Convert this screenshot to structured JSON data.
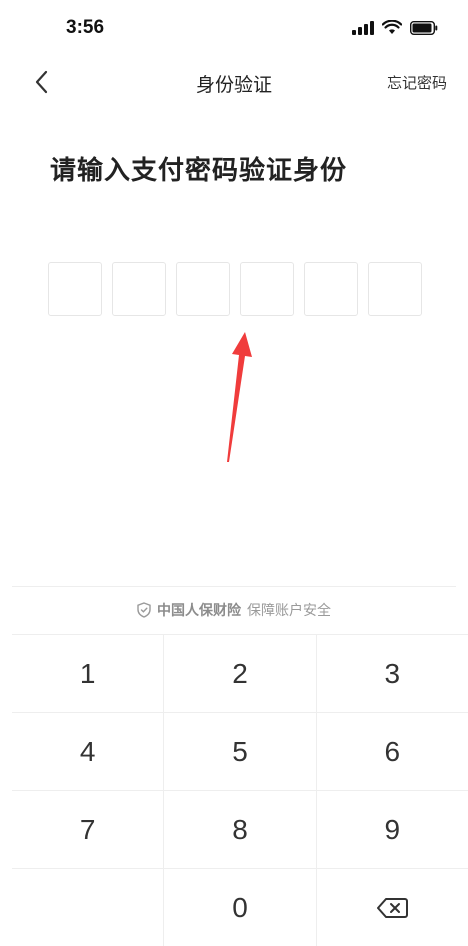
{
  "status_bar": {
    "time": "3:56"
  },
  "nav": {
    "title": "身份验证",
    "forgot_password": "忘记密码"
  },
  "heading": "请输入支付密码验证身份",
  "pin": {
    "length": 6
  },
  "security": {
    "brand": "中国人保财险",
    "tagline": "保障账户安全"
  },
  "keypad": {
    "rows": [
      [
        "1",
        "2",
        "3"
      ],
      [
        "4",
        "5",
        "6"
      ],
      [
        "7",
        "8",
        "9"
      ],
      [
        "",
        "0",
        "backspace"
      ]
    ]
  },
  "colors": {
    "arrow": "#f03c3c",
    "divider": "#eeeeee",
    "muted_text": "#9a9a9a"
  },
  "icons": [
    "signal-icon",
    "wifi-icon",
    "battery-icon",
    "back-chevron-icon",
    "shield-icon",
    "backspace-icon"
  ]
}
